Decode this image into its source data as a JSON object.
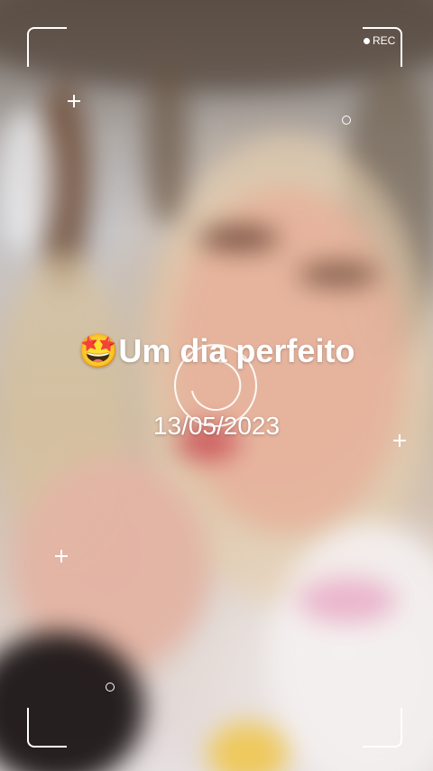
{
  "overlay": {
    "rec_label": "REC",
    "title": "🤩Um dia perfeito",
    "date": "13/05/2023"
  }
}
